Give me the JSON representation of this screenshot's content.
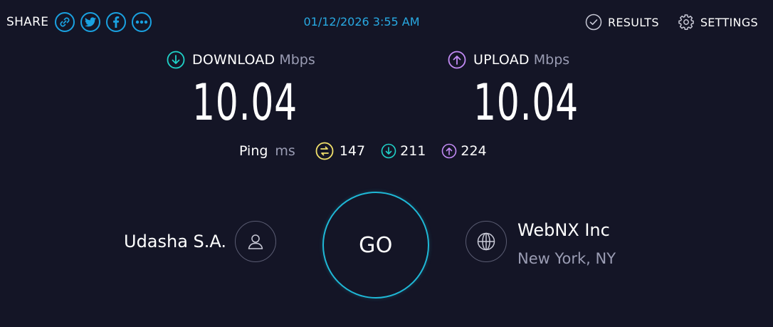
{
  "share": {
    "label": "SHARE",
    "buttons": [
      {
        "icon": "link-icon"
      },
      {
        "icon": "twitter-icon"
      },
      {
        "icon": "facebook-icon"
      },
      {
        "icon": "more-icon"
      }
    ],
    "accent": "#1aa1e0"
  },
  "datetime": "01/12/2026 3:55 AM",
  "nav": {
    "results_label": "RESULTS",
    "settings_label": "SETTINGS"
  },
  "download": {
    "title": "DOWNLOAD",
    "unit": "Mbps",
    "value": "10.04",
    "icon_color": "#1fd2c8"
  },
  "upload": {
    "title": "UPLOAD",
    "unit": "Mbps",
    "value": "10.04",
    "icon_color": "#c38bf5"
  },
  "ping": {
    "label": "Ping",
    "unit": "ms",
    "idle": "147",
    "download": "211",
    "upload": "224",
    "idle_color": "#f2e16b"
  },
  "isp": {
    "name": "Udasha S.A."
  },
  "go": {
    "label": "GO",
    "ring_color": "#1fb8d6"
  },
  "server": {
    "name": "WebNX Inc",
    "location": "New York, NY"
  },
  "colors": {
    "background": "#141526",
    "muted_text": "#9a9cb3"
  }
}
